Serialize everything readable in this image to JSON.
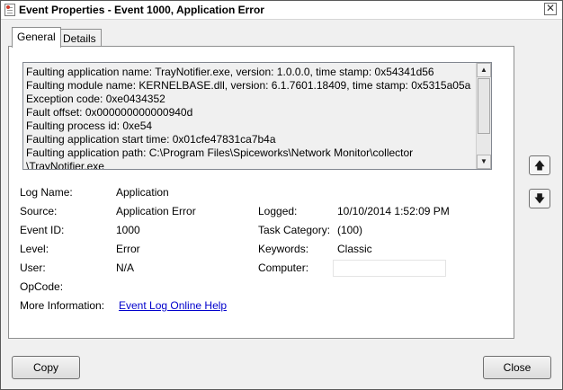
{
  "window": {
    "title": "Event Properties - Event 1000, Application Error",
    "close_glyph": "✕"
  },
  "tabs": [
    {
      "label": "General",
      "active": true
    },
    {
      "label": "Details",
      "active": false
    }
  ],
  "description": {
    "lines": [
      "Faulting application name: TrayNotifier.exe, version: 1.0.0.0, time stamp: 0x54341d56",
      "Faulting module name: KERNELBASE.dll, version: 6.1.7601.18409, time stamp: 0x5315a05a",
      "Exception code: 0xe0434352",
      "Fault offset: 0x000000000000940d",
      "Faulting process id: 0xe54",
      "Faulting application start time: 0x01cfe47831ca7b4a",
      "Faulting application path: C:\\Program Files\\Spiceworks\\Network Monitor\\collector",
      "\\TrayNotifier.exe"
    ],
    "scroll_up_glyph": "▲",
    "scroll_down_glyph": "▼"
  },
  "fields": {
    "log_name": {
      "label": "Log Name:",
      "value": "Application"
    },
    "source": {
      "label": "Source:",
      "value": "Application Error"
    },
    "logged": {
      "label": "Logged:",
      "value": "10/10/2014 1:52:09 PM"
    },
    "event_id": {
      "label": "Event ID:",
      "value": "1000"
    },
    "task_category": {
      "label": "Task Category:",
      "value": "(100)"
    },
    "level": {
      "label": "Level:",
      "value": "Error"
    },
    "keywords": {
      "label": "Keywords:",
      "value": "Classic"
    },
    "user": {
      "label": "User:",
      "value": "N/A"
    },
    "computer": {
      "label": "Computer:",
      "value": ""
    },
    "opcode": {
      "label": "OpCode:",
      "value": ""
    },
    "more_info": {
      "label": "More Information:",
      "link": "Event Log Online Help"
    }
  },
  "nav": {
    "up_glyph": "🡅",
    "down_glyph": "🡇"
  },
  "buttons": {
    "copy": "Copy",
    "close": "Close"
  }
}
